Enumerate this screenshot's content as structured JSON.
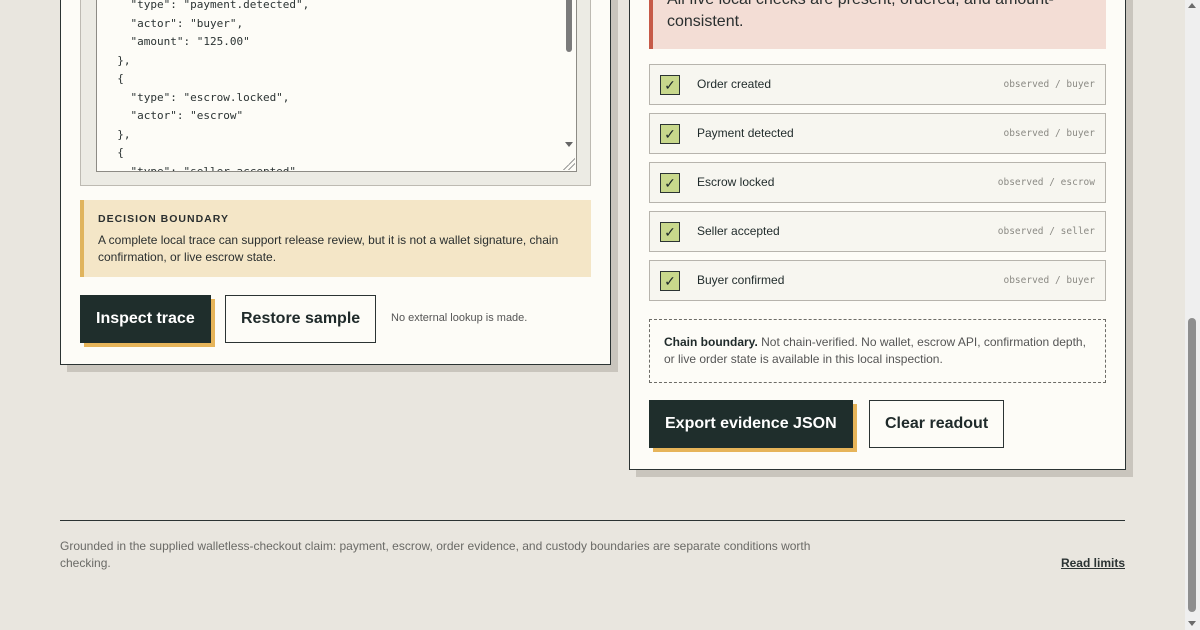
{
  "trace": {
    "code": "    \"type\": \"payment.detected\",\n    \"actor\": \"buyer\",\n    \"amount\": \"125.00\"\n  },\n  {\n    \"type\": \"escrow.locked\",\n    \"actor\": \"escrow\"\n  },\n  {\n    \"type\": \"seller.accepted\","
  },
  "decision": {
    "title": "DECISION BOUNDARY",
    "text": "A complete local trace can support release review, but it is not a wallet signature, chain confirmation, or live escrow state."
  },
  "left_actions": {
    "inspect": "Inspect trace",
    "restore": "Restore sample",
    "note": "No external lookup is made."
  },
  "verdict": {
    "text": "All five local checks are present, ordered, and amount-consistent."
  },
  "checks": [
    {
      "label": "Order created",
      "meta": "observed / buyer",
      "checked": true
    },
    {
      "label": "Payment detected",
      "meta": "observed / buyer",
      "checked": true
    },
    {
      "label": "Escrow locked",
      "meta": "observed / escrow",
      "checked": true
    },
    {
      "label": "Seller accepted",
      "meta": "observed / seller",
      "checked": true
    },
    {
      "label": "Buyer confirmed",
      "meta": "observed / buyer",
      "checked": true
    }
  ],
  "chain": {
    "title": "Chain boundary.",
    "text": " Not chain-verified. No wallet, escrow API, confirmation depth, or live order state is available in this local inspection."
  },
  "right_actions": {
    "export": "Export evidence JSON",
    "clear": "Clear readout"
  },
  "footer": {
    "text": "Grounded in the supplied walletless-checkout claim: payment, escrow, order evidence, and custody boundaries are separate conditions worth checking.",
    "link": "Read limits"
  },
  "check_glyph": "✓"
}
